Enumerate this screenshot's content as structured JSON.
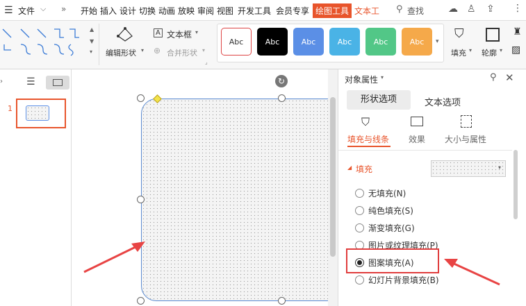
{
  "menubar": {
    "file_label": "文件",
    "items": [
      "开始",
      "插入",
      "设计",
      "切换",
      "动画",
      "放映",
      "审阅",
      "视图",
      "开发工具",
      "会员专享"
    ],
    "active_tab": "绘图工具",
    "next_tab": "文本工",
    "search_label": "查找"
  },
  "ribbon": {
    "edit_shape_label": "编辑形状",
    "textbox_label": "文本框",
    "merge_shape_label": "合并形状",
    "style_label": "Abc",
    "style_colors": [
      "#ffffff",
      "#000000",
      "#5b8fe6",
      "#4ab3e6",
      "#52c787",
      "#f5a94a"
    ],
    "fill_label": "填充",
    "outline_label": "轮廓"
  },
  "slides": {
    "number": "1"
  },
  "panel": {
    "title": "对象属性",
    "tabs": [
      "形状选项",
      "文本选项"
    ],
    "subtabs": [
      "填充与线条",
      "效果",
      "大小与属性"
    ],
    "section_title": "填充",
    "options": [
      {
        "label": "无填充(N)",
        "selected": false
      },
      {
        "label": "纯色填充(S)",
        "selected": false
      },
      {
        "label": "渐变填充(G)",
        "selected": false
      },
      {
        "label": "图片或纹理填充(P)",
        "selected": false
      },
      {
        "label": "图案填充(A)",
        "selected": true
      },
      {
        "label": "幻灯片背景填充(B)",
        "selected": false
      }
    ]
  },
  "colors": {
    "accent": "#e8542b",
    "highlight_box": "#e03c3c",
    "arrow": "#e84444"
  }
}
